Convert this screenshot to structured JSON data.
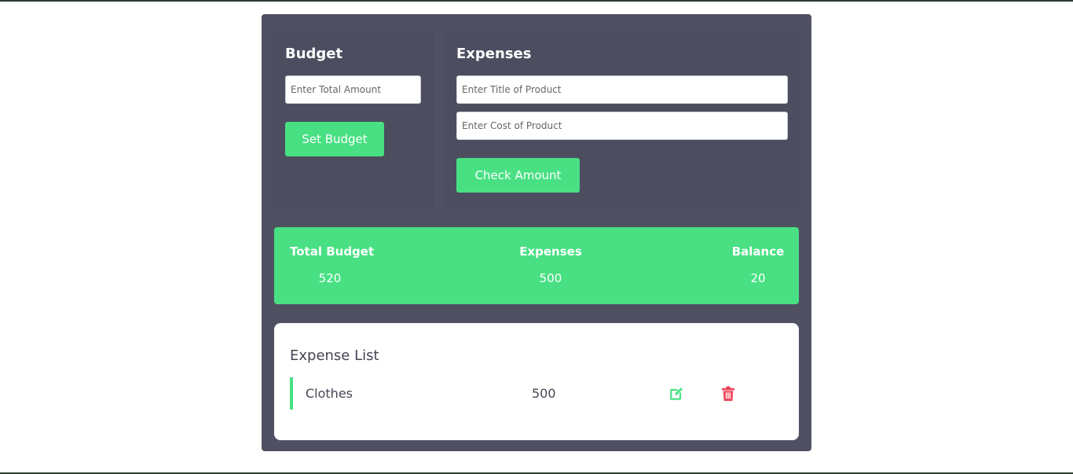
{
  "budget": {
    "heading": "Budget",
    "amount_placeholder": "Enter Total Amount",
    "amount_value": "",
    "set_label": "Set Budget"
  },
  "expenses": {
    "heading": "Expenses",
    "title_placeholder": "Enter Title of Product",
    "title_value": "",
    "cost_placeholder": "Enter Cost of Product",
    "cost_value": "",
    "check_label": "Check Amount"
  },
  "summary": {
    "total_label": "Total Budget",
    "total_value": "520",
    "expenses_label": "Expenses",
    "expenses_value": "500",
    "balance_label": "Balance",
    "balance_value": "20"
  },
  "list": {
    "heading": "Expense List",
    "items": [
      {
        "title": "Clothes",
        "cost": "500",
        "edit_icon": "edit-icon",
        "delete_icon": "trash-icon"
      }
    ]
  },
  "colors": {
    "accent": "#48e083",
    "panel": "#4f5163",
    "danger": "#f0415a"
  }
}
